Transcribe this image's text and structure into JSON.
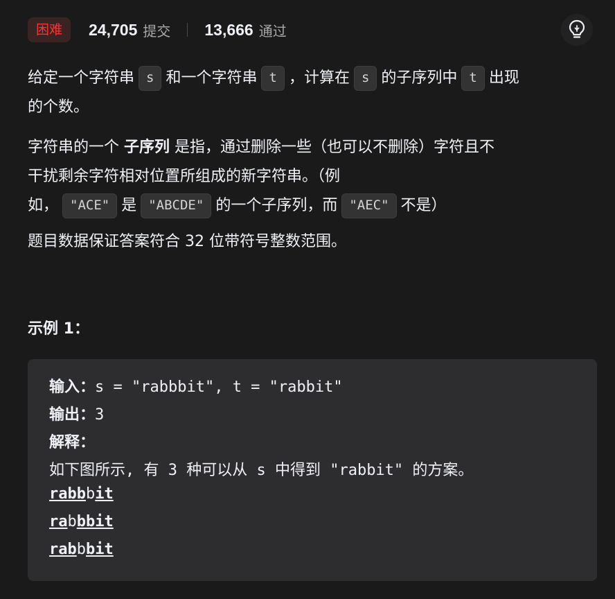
{
  "header": {
    "difficulty": "困难",
    "submissions": "24,705",
    "submissions_label": "提交",
    "accepted": "13,666",
    "accepted_label": "通过",
    "hint_icon": "lightbulb-icon"
  },
  "description": {
    "p1": {
      "t1": "给定一个字符串",
      "c1": "s",
      "t2": "和一个字符串",
      "c2": "t",
      "t3": "，计算在",
      "c3": "s",
      "t4": "的子序列中",
      "c4": "t",
      "t5": "出现",
      "t6": "的个数。"
    },
    "p2": {
      "t1": "字符串的一个",
      "b1": "子序列",
      "t2": "是指，通过删除一些（也可以不删除）字符且不",
      "t3": "干扰剩余字符相对位置所组成的新字符串。（例",
      "t4": "如，",
      "c1": "\"ACE\"",
      "t5": "是",
      "c2": "\"ABCDE\"",
      "t6": "的一个子序列，而",
      "c3": "\"AEC\"",
      "t7": "不是）"
    },
    "p3": "题目数据保证答案符合 32 位带符号整数范围。"
  },
  "example": {
    "title": "示例 1：",
    "input_label": "输入：",
    "input_value": "s = \"rabbbit\", t = \"rabbit\"",
    "output_label": "输出：",
    "output_value": "3",
    "explain_label": "解释：",
    "explain_text": "如下图所示, 有 3 种可以从 s 中得到 \"rabbit\" 的方案。",
    "lines": [
      [
        {
          "text": "rabb",
          "u": true
        },
        {
          "text": "b",
          "u": false
        },
        {
          "text": "it",
          "u": true
        }
      ],
      [
        {
          "text": "ra",
          "u": true
        },
        {
          "text": "b",
          "u": false
        },
        {
          "text": "bbit",
          "u": true
        }
      ],
      [
        {
          "text": "rab",
          "u": true
        },
        {
          "text": "b",
          "u": false
        },
        {
          "text": "bit",
          "u": true
        }
      ]
    ]
  },
  "colors": {
    "background": "#1a1a1a",
    "difficulty_text": "#f63636",
    "difficulty_bg": "#3a2323",
    "example_bg": "#2d2d30"
  }
}
